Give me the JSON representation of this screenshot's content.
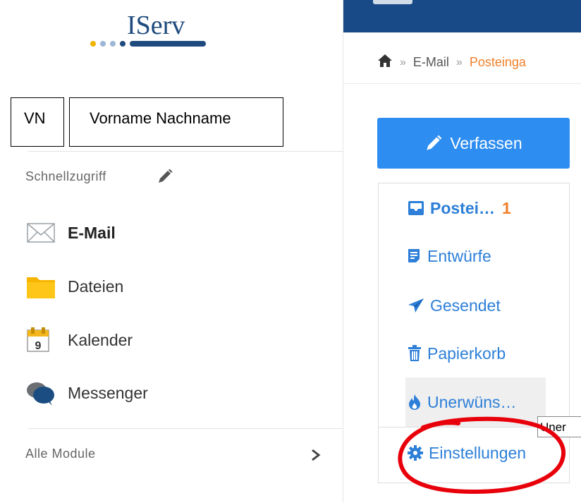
{
  "app": {
    "logo_text": "IServ"
  },
  "user": {
    "initials": "VN",
    "name": "Vorname Nachname"
  },
  "sidebar": {
    "quick_access_label": "Schnellzugriff",
    "items": [
      {
        "label": "E-Mail",
        "icon": "envelope-icon",
        "active": true
      },
      {
        "label": "Dateien",
        "icon": "folder-icon",
        "active": false
      },
      {
        "label": "Kalender",
        "icon": "calendar-icon",
        "active": false,
        "calendar_day": "9"
      },
      {
        "label": "Messenger",
        "icon": "chat-bubbles-icon",
        "active": false
      }
    ],
    "all_modules_label": "Alle Module"
  },
  "breadcrumb": {
    "home_icon": "home-icon",
    "items": [
      "E-Mail",
      "Posteinga"
    ]
  },
  "mail": {
    "compose_label": "Verfassen",
    "folders": [
      {
        "label": "Postei…",
        "count": "1",
        "icon": "inbox-icon"
      },
      {
        "label": "Entwürfe",
        "icon": "drafts-icon"
      },
      {
        "label": "Gesendet",
        "icon": "paper-plane-icon"
      },
      {
        "label": "Papierkorb",
        "icon": "trash-icon"
      },
      {
        "label": "Unerwüns…",
        "icon": "flame-icon"
      }
    ],
    "settings_label": "Einstellungen",
    "tooltip": "Uner"
  },
  "colors": {
    "brand_blue": "#174a86",
    "link_blue": "#2d7fd8",
    "button_blue": "#2d8df0",
    "accent_orange": "#f0802a",
    "annotation_red": "#e8000b"
  }
}
